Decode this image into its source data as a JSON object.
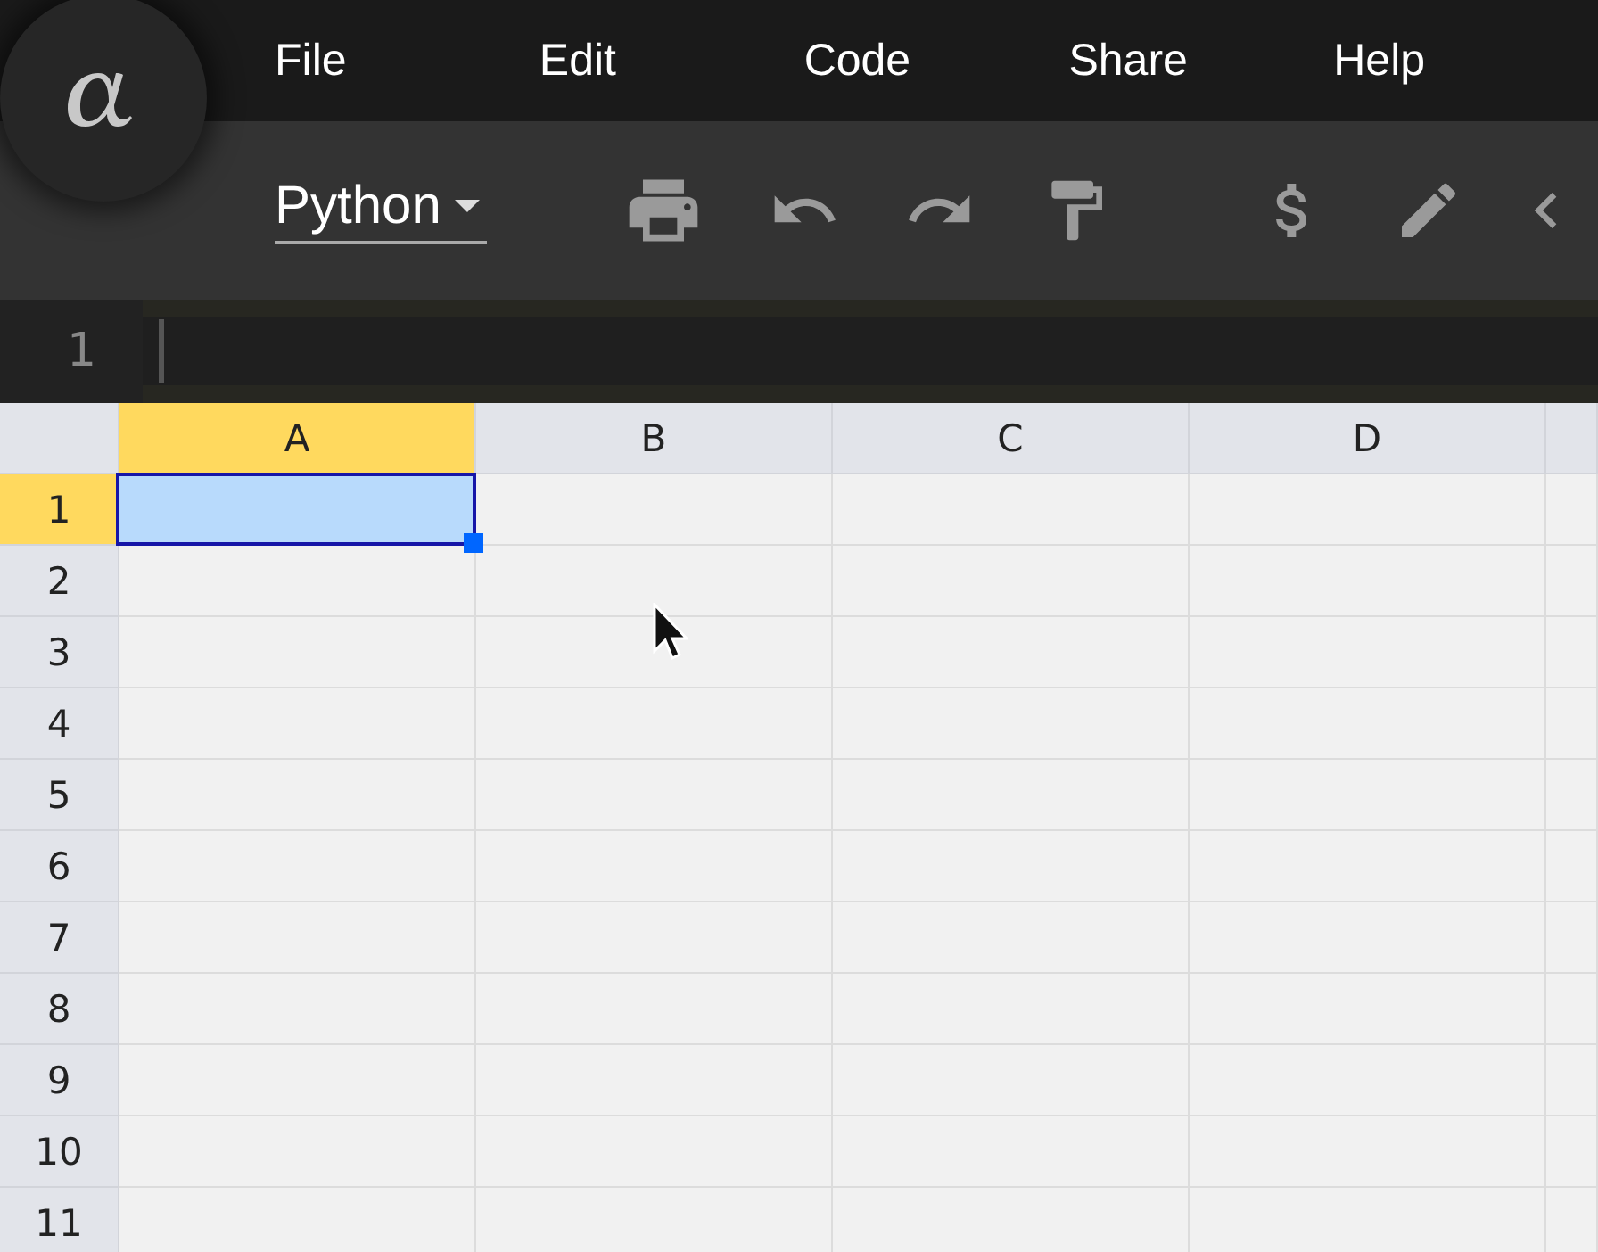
{
  "menu": [
    {
      "label": "File"
    },
    {
      "label": "Edit"
    },
    {
      "label": "Code"
    },
    {
      "label": "Share"
    },
    {
      "label": "Help"
    }
  ],
  "toolbar": {
    "language": "Python"
  },
  "editor": {
    "line_number": "1"
  },
  "columns": [
    {
      "label": "A",
      "selected": true
    },
    {
      "label": "B",
      "selected": false
    },
    {
      "label": "C",
      "selected": false
    },
    {
      "label": "D",
      "selected": false
    }
  ],
  "rows": [
    {
      "label": "1",
      "selected": true
    },
    {
      "label": "2",
      "selected": false
    },
    {
      "label": "3",
      "selected": false
    },
    {
      "label": "4",
      "selected": false
    },
    {
      "label": "5",
      "selected": false
    },
    {
      "label": "6",
      "selected": false
    },
    {
      "label": "7",
      "selected": false
    },
    {
      "label": "8",
      "selected": false
    },
    {
      "label": "9",
      "selected": false
    },
    {
      "label": "10",
      "selected": false
    },
    {
      "label": "11",
      "selected": false
    }
  ]
}
